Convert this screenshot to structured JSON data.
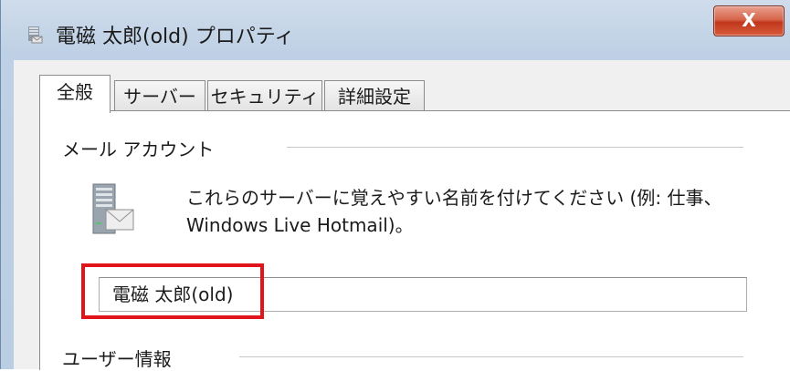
{
  "window": {
    "title": "電磁 太郎(old) プロパティ",
    "close_glyph": "X"
  },
  "tabs": [
    {
      "label": "全般",
      "active": true
    },
    {
      "label": "サーバー",
      "active": false
    },
    {
      "label": "セキュリティ",
      "active": false
    },
    {
      "label": "詳細設定",
      "active": false
    }
  ],
  "mail_account": {
    "group_label": "メール アカウント",
    "description": "これらのサーバーに覚えやすい名前を付けてください (例: 仕事、Windows Live Hotmail)。",
    "account_name_value": "電磁 太郎(old)"
  },
  "user_info": {
    "group_label": "ユーザー情報"
  },
  "colors": {
    "highlight": "#e0141a",
    "close_button": "#c1361c",
    "frame": "#bed0e5"
  }
}
